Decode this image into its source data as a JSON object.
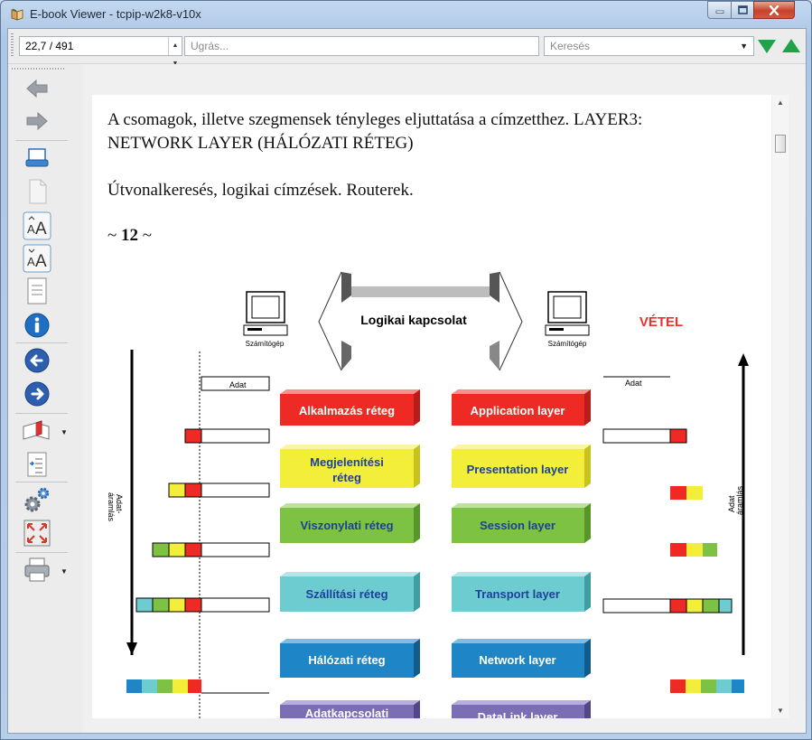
{
  "window": {
    "title": "E-book Viewer - tcpip-w2k8-v10x",
    "controls": [
      "minimize-button",
      "maximize-button",
      "close-button"
    ]
  },
  "toolbar": {
    "position_value": "22,7 / 491",
    "goto_placeholder": "Ugrás...",
    "search_placeholder": "Keresés",
    "icons": [
      "find-next-icon",
      "find-previous-icon"
    ]
  },
  "sidebar": {
    "buttons": [
      "back-icon",
      "forward-icon",
      "print-layout-icon",
      "copy-icon",
      "font-larger-icon",
      "font-smaller-icon",
      "document-icon",
      "info-icon",
      "previous-page-icon",
      "next-page-icon",
      "bookmarks-icon",
      "table-of-contents-icon",
      "settings-icon",
      "fullscreen-icon",
      "print-icon"
    ]
  },
  "page": {
    "paragraph1": "A csomagok, illetve szegmensek tényleges eljuttatása a címzetthez. LAYER3: NETWORK LAYER (HÁLÓZATI RÉTEG)",
    "paragraph1_line1": "A csomagok, illetve szegmensek tényleges eljuttatása a címzetthez. LAYER3:",
    "paragraph1_line2": "NETWORK LAYER (HÁLÓZATI RÉTEG)",
    "paragraph2": "Útvonalkeresés, logikai címzések. Routerek.",
    "page_marker_prefix": "~ ",
    "page_marker_number": "12",
    "page_marker_suffix": " ~"
  },
  "diagram": {
    "logical_connection": "Logikai kapcsolat",
    "receive_label": "VÉTEL",
    "computer_label_left": "Számítógép",
    "computer_label_right": "Számítógép",
    "data_label_left": "Adat",
    "data_label_right": "Adat",
    "flow_label_left_1": "Adat-",
    "flow_label_left_2": "áramlás",
    "flow_label_right_1": "Adat",
    "flow_label_right_2": "áramlás",
    "layers_left": [
      "Alkalmazás réteg",
      "Megjelenítési",
      "réteg",
      "Viszonylati réteg",
      "Szállítási réteg",
      "Hálózati réteg",
      "Adatkapcsolati"
    ],
    "layers_right": [
      "Application layer",
      "Presentation layer",
      "Session layer",
      "Transport layer",
      "Network layer",
      "DataLink layer"
    ],
    "colors": {
      "application": "#ee2a24",
      "presentation": "#f2ee3a",
      "session": "#7dc242",
      "transport": "#6cccd0",
      "network": "#1e86c6",
      "datalink": "#7b6eb5",
      "receive_text": "#e8322a"
    }
  }
}
